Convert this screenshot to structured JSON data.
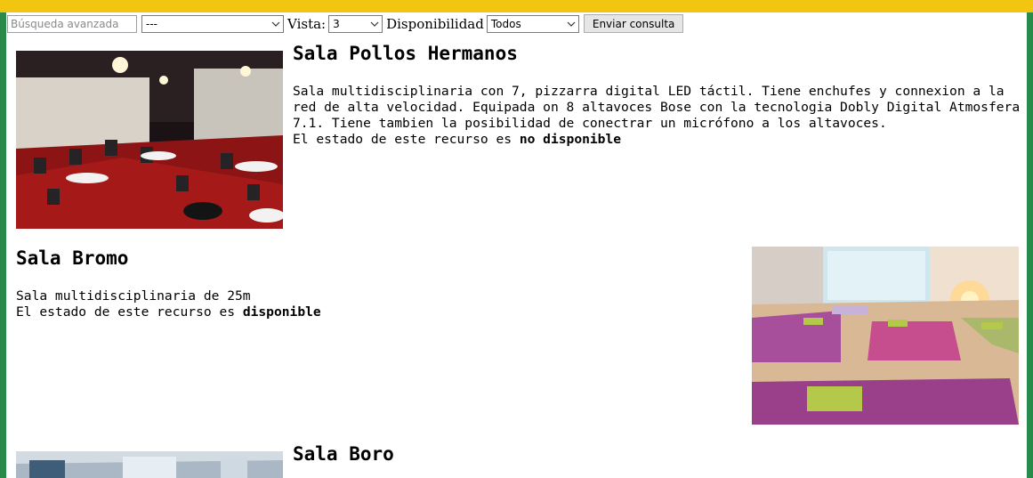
{
  "search": {
    "placeholder": "Búsqueda avanzada"
  },
  "filters": {
    "category_value": "---",
    "vista_label": "Vista:",
    "vista_value": "3",
    "disponibilidad_label": "Disponibilidad",
    "disponibilidad_value": "Todos",
    "submit_label": "Enviar consulta"
  },
  "rooms": [
    {
      "title": "Sala Pollos Hermanos",
      "description": "Sala multidisciplinaria con 7, pizzarra digital LED táctil. Tiene enchufes y connexion a la red de alta velocidad. Equipada on 8 altavoces Bose con la tecnologia Dobly Digital Atmosfera 7.1. Tiene tambien la posibilidad de conectrar un micrófono a los altavoces.",
      "status_prefix": "El estado de este recurso es",
      "status": "no disponible",
      "image": "event-hall-photo"
    },
    {
      "title": "Sala Bromo",
      "description": "Sala multidisciplinaria de 25m",
      "status_prefix": "El estado de este recurso es",
      "status": "disponible",
      "image": "yoga-studio-photo"
    },
    {
      "title": "Sala Boro",
      "image": "conference-room-photo"
    }
  ],
  "colors": {
    "top_bar": "#f2c511",
    "side_border": "#2a8a4a"
  }
}
